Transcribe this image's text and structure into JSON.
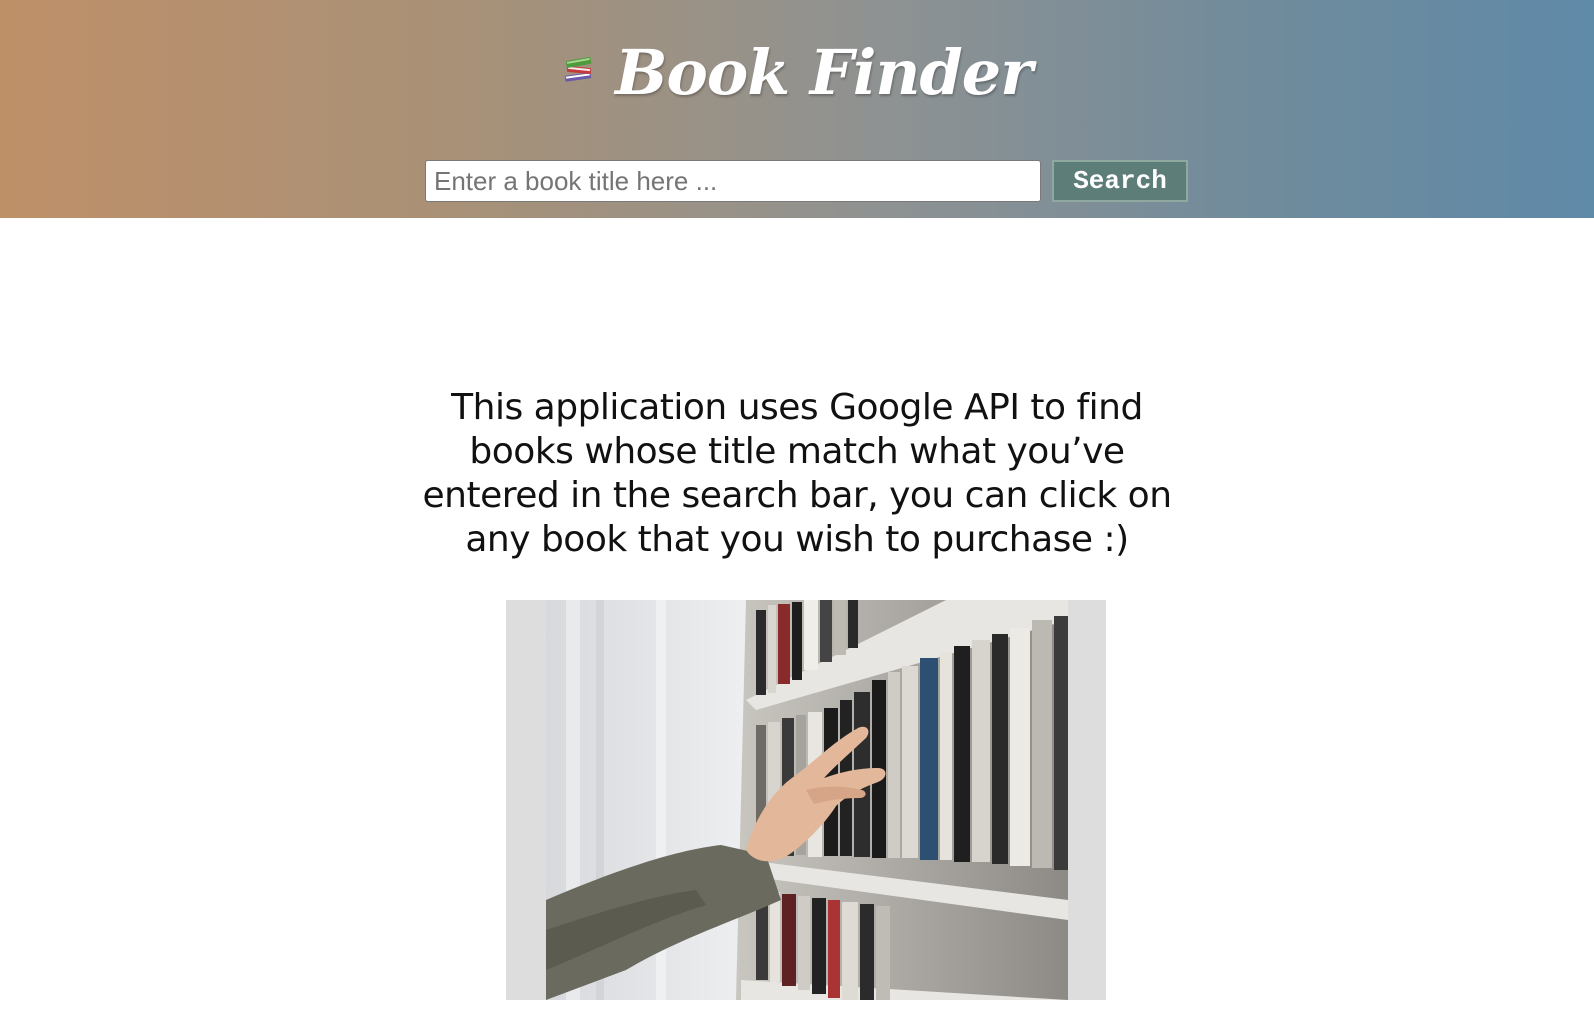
{
  "header": {
    "title": "Book Finder",
    "logo_icon": "books-stack-icon",
    "gradient_colors": [
      "#bf9068",
      "#8f9292",
      "#5f8aa8"
    ]
  },
  "search": {
    "placeholder": "Enter a book title here ...",
    "value": "",
    "button_label": "Search",
    "button_color": "#5d7d78"
  },
  "main": {
    "intro_text": "This application uses Google API to find books whose title match what you’ve entered in the search bar, you can click on any book that you wish to purchase :)",
    "hero_image": "hand-reaching-bookshelf-photo"
  }
}
